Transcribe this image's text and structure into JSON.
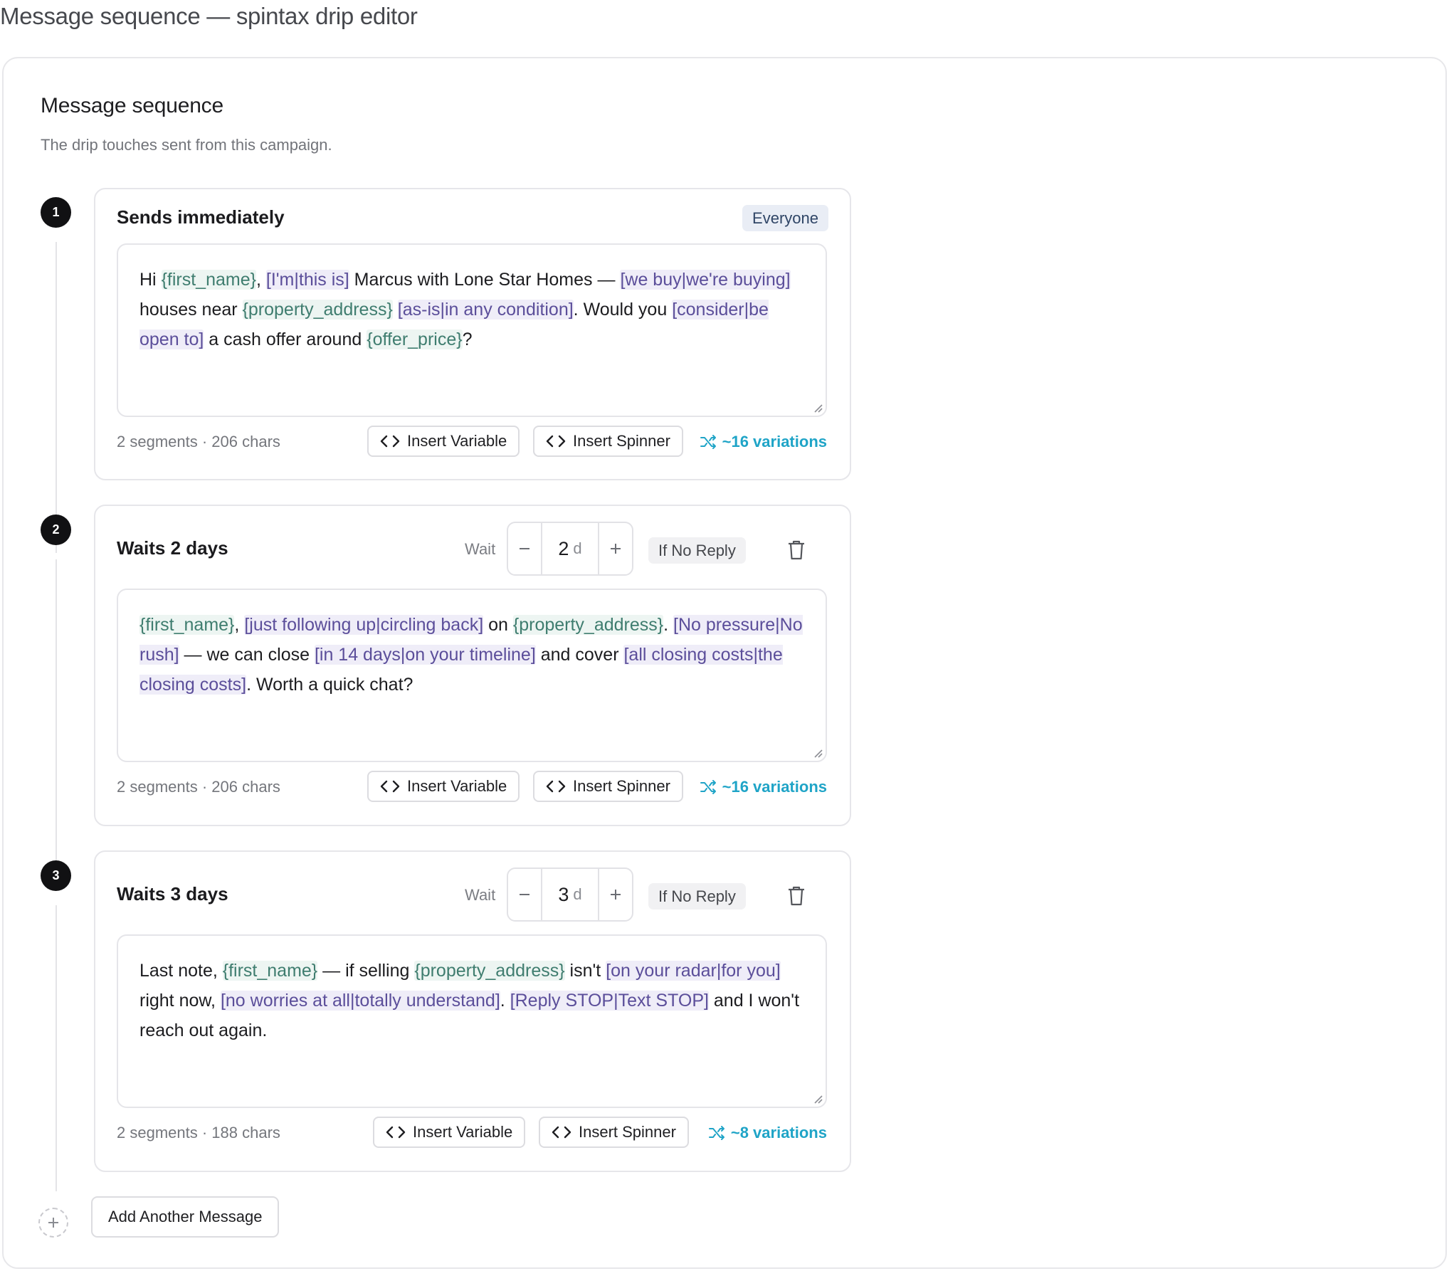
{
  "page": {
    "title": "Message sequence — spintax drip editor"
  },
  "card": {
    "title": "Message sequence",
    "subtitle": "The drip touches sent from this campaign."
  },
  "steps": [
    {
      "number": "1",
      "label": "Sends immediately",
      "audience": "Everyone",
      "message": [
        {
          "t": "text",
          "v": "Hi "
        },
        {
          "t": "var",
          "v": "{first_name}"
        },
        {
          "t": "text",
          "v": ", "
        },
        {
          "t": "spin",
          "v": "[I'm|this is]"
        },
        {
          "t": "text",
          "v": " Marcus with Lone Star Homes — "
        },
        {
          "t": "spin",
          "v": "[we buy|we're buying]"
        },
        {
          "t": "text",
          "v": " houses near "
        },
        {
          "t": "var",
          "v": "{property_address}"
        },
        {
          "t": "text",
          "v": " "
        },
        {
          "t": "spin",
          "v": "[as-is|in any condition]"
        },
        {
          "t": "text",
          "v": ". Would you "
        },
        {
          "t": "spin",
          "v": "[consider|be open to]"
        },
        {
          "t": "text",
          "v": " a cash offer around "
        },
        {
          "t": "var",
          "v": "{offer_price}"
        },
        {
          "t": "text",
          "v": "?"
        }
      ],
      "meta": "2 segments · 206 chars",
      "insert_variable": "Insert Variable",
      "insert_spinner": "Insert Spinner",
      "variations": "~16 variations"
    },
    {
      "number": "2",
      "label": "Waits 2 days",
      "wait_label": "Wait",
      "wait_value": "2",
      "wait_unit": "d",
      "condition": "If No Reply",
      "message": [
        {
          "t": "var",
          "v": "{first_name}"
        },
        {
          "t": "text",
          "v": ", "
        },
        {
          "t": "spin",
          "v": "[just following up|circling back]"
        },
        {
          "t": "text",
          "v": " on "
        },
        {
          "t": "var",
          "v": "{property_address}"
        },
        {
          "t": "text",
          "v": ". "
        },
        {
          "t": "spin",
          "v": "[No pressure|No rush]"
        },
        {
          "t": "text",
          "v": " — we can close "
        },
        {
          "t": "spin",
          "v": "[in 14 days|on your timeline]"
        },
        {
          "t": "text",
          "v": " and cover "
        },
        {
          "t": "spin",
          "v": "[all closing costs|the closing costs]"
        },
        {
          "t": "text",
          "v": ". Worth a quick chat?"
        }
      ],
      "meta": "2 segments · 206 chars",
      "insert_variable": "Insert Variable",
      "insert_spinner": "Insert Spinner",
      "variations": "~16 variations"
    },
    {
      "number": "3",
      "label": "Waits 3 days",
      "wait_label": "Wait",
      "wait_value": "3",
      "wait_unit": "d",
      "condition": "If No Reply",
      "message": [
        {
          "t": "text",
          "v": "Last note, "
        },
        {
          "t": "var",
          "v": "{first_name}"
        },
        {
          "t": "text",
          "v": " — if selling "
        },
        {
          "t": "var",
          "v": "{property_address}"
        },
        {
          "t": "text",
          "v": " isn't "
        },
        {
          "t": "spin",
          "v": "[on your radar|for you]"
        },
        {
          "t": "text",
          "v": " right now, "
        },
        {
          "t": "spin",
          "v": "[no worries at all|totally understand]"
        },
        {
          "t": "text",
          "v": ". "
        },
        {
          "t": "spin",
          "v": "[Reply STOP|Text STOP]"
        },
        {
          "t": "text",
          "v": " and I won't reach out again."
        }
      ],
      "meta": "2 segments · 188 chars",
      "insert_variable": "Insert Variable",
      "insert_spinner": "Insert Spinner",
      "variations": "~8 variations"
    }
  ],
  "add_message": {
    "label": "Add Another Message"
  },
  "icons": {
    "code": "code-brackets-icon",
    "shuffle": "shuffle-icon",
    "trash": "trash-icon",
    "minus": "minus-icon",
    "plus": "plus-icon",
    "resize": "resize-grip-icon"
  },
  "colors": {
    "variable": "#3f7d6f",
    "spinner": "#5b4e9a",
    "variations": "#1fa4c7",
    "step_number_bg": "#111113"
  }
}
